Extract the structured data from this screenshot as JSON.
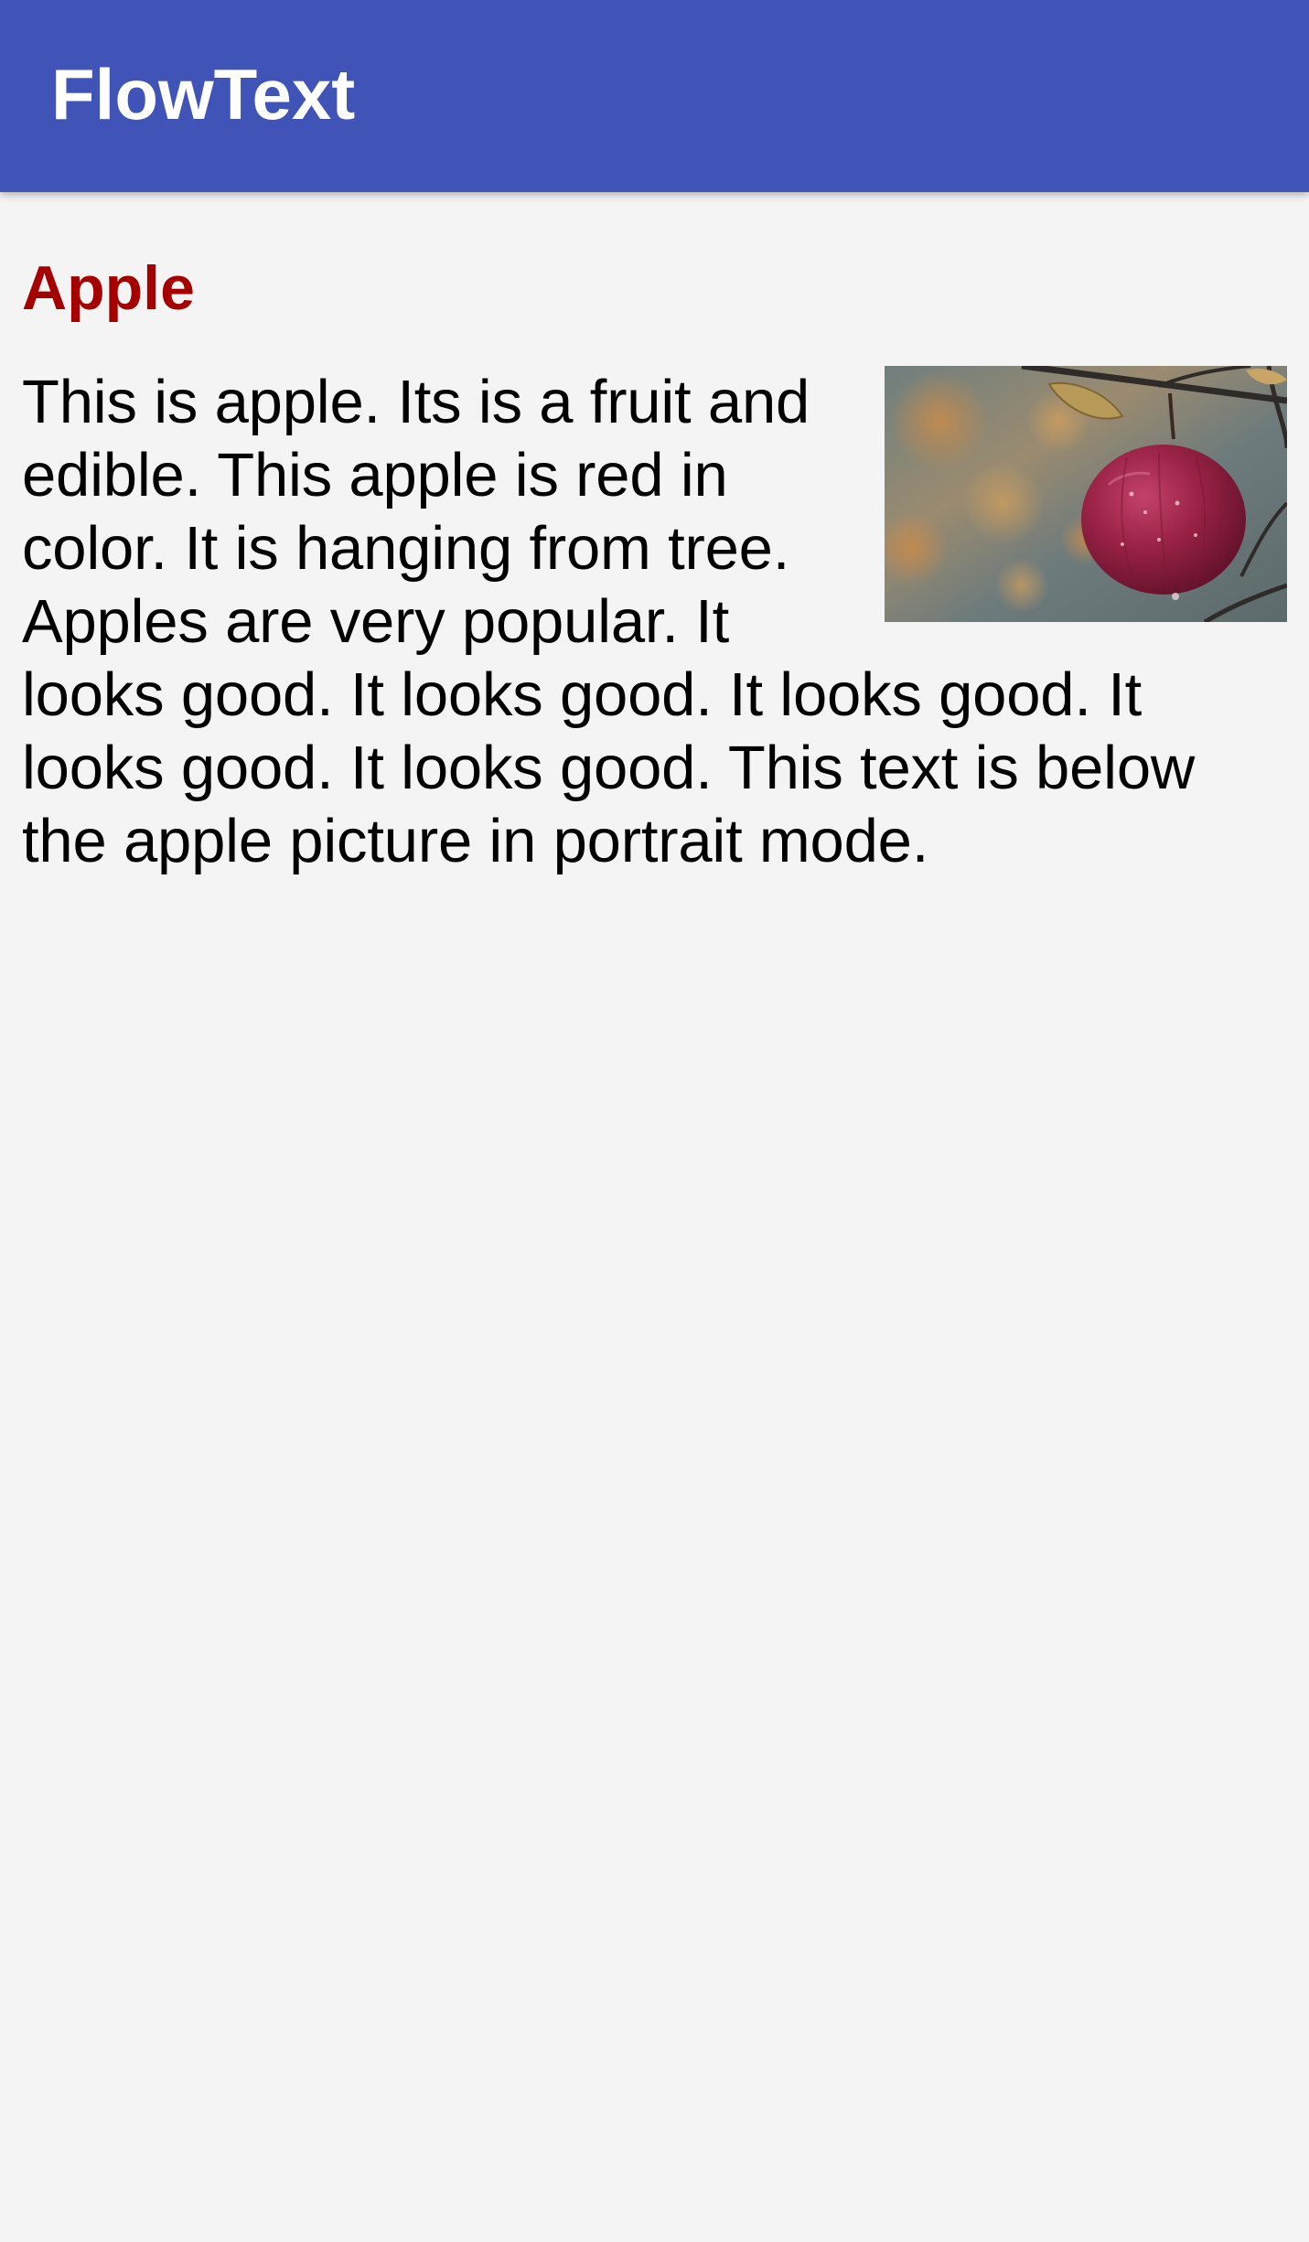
{
  "app_bar": {
    "title": "FlowText",
    "color": "#4053b7"
  },
  "article": {
    "heading": "Apple",
    "heading_color": "#a50000",
    "body": "This is apple. Its is a fruit and edible. This apple is red in color. It is hanging from tree. Apples are very popular. It looks good. It looks good. It looks good. It looks good. It looks good. This text is below the apple picture in portrait mode.",
    "image": {
      "subject": "red apple hanging from branch"
    }
  }
}
